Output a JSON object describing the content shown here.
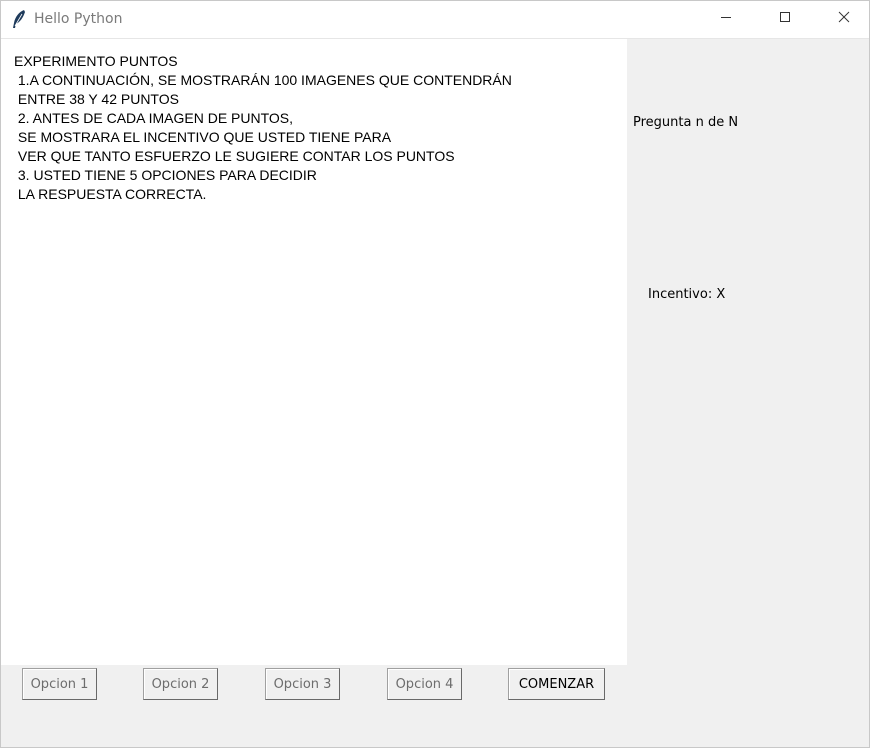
{
  "window": {
    "title": "Hello Python",
    "icon": "feather-icon",
    "controls": {
      "minimize_icon": "minimize-icon",
      "maximize_icon": "maximize-icon",
      "close_icon": "close-icon"
    }
  },
  "instructions": {
    "lines": [
      "EXPERIMENTO PUNTOS",
      " 1.A CONTINUACIÓN, SE MOSTRARÁN 100 IMAGENES QUE CONTENDRÁN",
      " ENTRE 38 Y 42 PUNTOS",
      " 2. ANTES DE CADA IMAGEN DE PUNTOS,",
      " SE MOSTRARA EL INCENTIVO QUE USTED TIENE PARA",
      " VER QUE TANTO ESFUERZO LE SUGIERE CONTAR LOS PUNTOS",
      " 3. USTED TIENE 5 OPCIONES PARA DECIDIR",
      " LA RESPUESTA CORRECTA."
    ]
  },
  "side": {
    "question_label": "Pregunta n de N",
    "incentive_label": "Incentivo: X"
  },
  "buttons": {
    "option1": "Opcion 1",
    "option2": "Opcion 2",
    "option3": "Opcion 3",
    "option4": "Opcion 4",
    "start": "COMENZAR"
  },
  "colors": {
    "window_bg": "#f0f0f0",
    "text_area_bg": "#ffffff",
    "disabled_text": "#6d6d6d",
    "title_text": "#7a7a7a"
  }
}
